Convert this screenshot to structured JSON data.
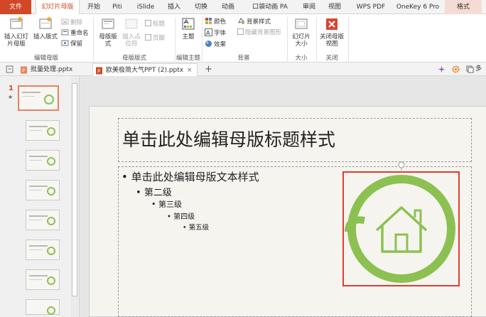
{
  "tabs": [
    "文件",
    "幻灯片母版",
    "开始",
    "Piti",
    "iSlide",
    "插入",
    "切换",
    "动画",
    "口袋动画 PA",
    "审阅",
    "视图",
    "WPS PDF",
    "OneKey 6 Pro",
    "格式"
  ],
  "ribbon": {
    "groups": {
      "edit_master": {
        "label": "编辑母版",
        "insert_master": "插入幻灯片母版",
        "insert_layout": "插入版式",
        "delete": "删除",
        "rename": "重命名",
        "preserve": "保留"
      },
      "master_layout": {
        "label": "母版版式",
        "master_layout_btn": "母版版式",
        "insert_placeholder": "插入占位符",
        "title_chk": "标题",
        "footer_chk": "页脚"
      },
      "edit_theme": {
        "label": "编辑主题",
        "theme": "主题"
      },
      "background": {
        "label": "背景",
        "colors": "颜色",
        "fonts": "字体",
        "effects": "效果",
        "bg_styles": "背景样式",
        "hide_bg": "隐藏背景图形"
      },
      "size": {
        "label": "大小",
        "slide_size": "幻灯片大小"
      },
      "close": {
        "label": "关闭",
        "close_master": "关闭母版视图"
      }
    }
  },
  "doc_tabs": [
    {
      "name": "批量处理.pptx"
    },
    {
      "name": "欧美极简大气PPT (2).pptx"
    }
  ],
  "doc_tab_close": "×",
  "doc_tab_new": "+",
  "right_tools_label": "多窗",
  "thumbs": {
    "first_number": "1",
    "first_star": "★"
  },
  "slide": {
    "title": "单击此处编辑母版标题样式",
    "levels": [
      "单击此处编辑母版文本样式",
      "第二级",
      "第三级",
      "第四级",
      "第五级"
    ],
    "bullet": "•"
  },
  "colors": {
    "accent": "#d24726",
    "green": "#8cc152",
    "selection": "#e03c31"
  }
}
